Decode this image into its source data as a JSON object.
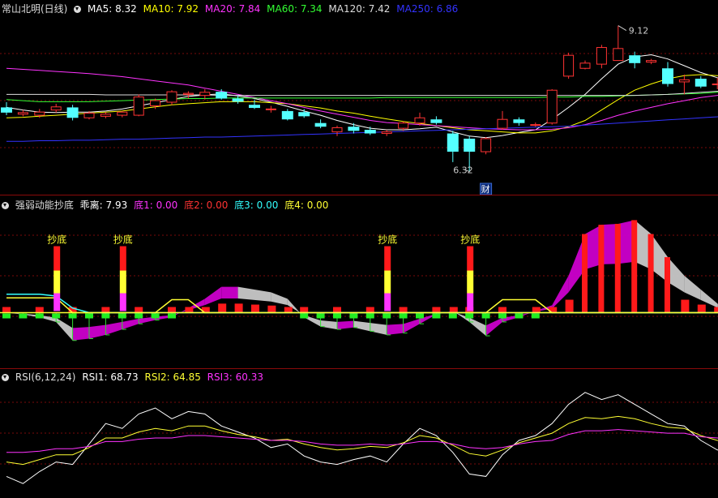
{
  "panel1": {
    "title": "常山北明(日线)",
    "ma": [
      {
        "label": "MA5: 8.32",
        "color": "#ffffff"
      },
      {
        "label": "MA10: 7.92",
        "color": "#ffff00"
      },
      {
        "label": "MA20: 7.84",
        "color": "#ff33ff"
      },
      {
        "label": "MA60: 7.34",
        "color": "#33ff33"
      },
      {
        "label": "MA120: 7.42",
        "color": "#dddddd"
      },
      {
        "label": "MA250: 6.86",
        "color": "#3333ff"
      }
    ],
    "high_label": "9.12",
    "low_label": "6.32",
    "cai_badge": "财"
  },
  "panel2": {
    "title": "强弱动能抄底",
    "items": [
      {
        "label": "乖离: 7.93",
        "color": "#ffffff"
      },
      {
        "label": "底1: 0.00",
        "color": "#ff33ff"
      },
      {
        "label": "底2: 0.00",
        "color": "#ff3333"
      },
      {
        "label": "底3: 0.00",
        "color": "#33ffff"
      },
      {
        "label": "底4: 0.00",
        "color": "#ffff33"
      }
    ],
    "buy_label": "抄底"
  },
  "panel3": {
    "title": "RSI(6,12,24)",
    "items": [
      {
        "label": "RSI1: 68.73",
        "color": "#ffffff"
      },
      {
        "label": "RSI2: 64.85",
        "color": "#ffff33"
      },
      {
        "label": "RSI3: 60.33",
        "color": "#ff33ff"
      }
    ]
  },
  "chart_data": [
    {
      "type": "candlestick",
      "title": "常山北明(日线)",
      "ylim": [
        6.0,
        9.3
      ],
      "candles": [
        {
          "o": 7.55,
          "h": 7.65,
          "l": 7.4,
          "c": 7.45
        },
        {
          "o": 7.42,
          "h": 7.5,
          "l": 7.38,
          "c": 7.45
        },
        {
          "o": 7.4,
          "h": 7.52,
          "l": 7.35,
          "c": 7.46
        },
        {
          "o": 7.5,
          "h": 7.62,
          "l": 7.45,
          "c": 7.56
        },
        {
          "o": 7.55,
          "h": 7.6,
          "l": 7.3,
          "c": 7.35
        },
        {
          "o": 7.35,
          "h": 7.48,
          "l": 7.32,
          "c": 7.44
        },
        {
          "o": 7.38,
          "h": 7.46,
          "l": 7.34,
          "c": 7.42
        },
        {
          "o": 7.4,
          "h": 7.48,
          "l": 7.36,
          "c": 7.46
        },
        {
          "o": 7.4,
          "h": 7.8,
          "l": 7.38,
          "c": 7.75
        },
        {
          "o": 7.58,
          "h": 7.72,
          "l": 7.52,
          "c": 7.68
        },
        {
          "o": 7.65,
          "h": 7.88,
          "l": 7.6,
          "c": 7.85
        },
        {
          "o": 7.8,
          "h": 7.86,
          "l": 7.72,
          "c": 7.82
        },
        {
          "o": 7.78,
          "h": 7.9,
          "l": 7.7,
          "c": 7.84
        },
        {
          "o": 7.85,
          "h": 7.9,
          "l": 7.7,
          "c": 7.72
        },
        {
          "o": 7.72,
          "h": 7.78,
          "l": 7.62,
          "c": 7.66
        },
        {
          "o": 7.6,
          "h": 7.7,
          "l": 7.52,
          "c": 7.54
        },
        {
          "o": 7.52,
          "h": 7.58,
          "l": 7.45,
          "c": 7.52
        },
        {
          "o": 7.48,
          "h": 7.52,
          "l": 7.3,
          "c": 7.32
        },
        {
          "o": 7.46,
          "h": 7.52,
          "l": 7.35,
          "c": 7.38
        },
        {
          "o": 7.25,
          "h": 7.32,
          "l": 7.15,
          "c": 7.18
        },
        {
          "o": 7.08,
          "h": 7.2,
          "l": 7.0,
          "c": 7.16
        },
        {
          "o": 7.18,
          "h": 7.25,
          "l": 7.05,
          "c": 7.1
        },
        {
          "o": 7.12,
          "h": 7.18,
          "l": 7.02,
          "c": 7.05
        },
        {
          "o": 7.05,
          "h": 7.12,
          "l": 7.0,
          "c": 7.08
        },
        {
          "o": 7.15,
          "h": 7.28,
          "l": 7.1,
          "c": 7.25
        },
        {
          "o": 7.25,
          "h": 7.45,
          "l": 7.2,
          "c": 7.35
        },
        {
          "o": 7.32,
          "h": 7.38,
          "l": 7.22,
          "c": 7.25
        },
        {
          "o": 7.05,
          "h": 7.1,
          "l": 6.5,
          "c": 6.7
        },
        {
          "o": 6.95,
          "h": 7.0,
          "l": 6.32,
          "c": 6.7
        },
        {
          "o": 6.7,
          "h": 6.98,
          "l": 6.65,
          "c": 6.95
        },
        {
          "o": 7.15,
          "h": 7.48,
          "l": 7.12,
          "c": 7.32
        },
        {
          "o": 7.32,
          "h": 7.36,
          "l": 7.2,
          "c": 7.25
        },
        {
          "o": 7.22,
          "h": 7.26,
          "l": 7.18,
          "c": 7.22
        },
        {
          "o": 7.25,
          "h": 7.9,
          "l": 7.22,
          "c": 7.88
        },
        {
          "o": 8.15,
          "h": 8.6,
          "l": 8.1,
          "c": 8.55
        },
        {
          "o": 8.3,
          "h": 8.45,
          "l": 8.28,
          "c": 8.4
        },
        {
          "o": 8.38,
          "h": 8.75,
          "l": 8.3,
          "c": 8.7
        },
        {
          "o": 8.45,
          "h": 9.12,
          "l": 8.45,
          "c": 8.68
        },
        {
          "o": 8.55,
          "h": 8.62,
          "l": 8.3,
          "c": 8.4
        },
        {
          "o": 8.42,
          "h": 8.48,
          "l": 8.38,
          "c": 8.45
        },
        {
          "o": 8.3,
          "h": 8.42,
          "l": 7.95,
          "c": 8.0
        },
        {
          "o": 8.04,
          "h": 8.18,
          "l": 7.8,
          "c": 8.08
        },
        {
          "o": 8.1,
          "h": 8.15,
          "l": 7.92,
          "c": 7.95
        },
        {
          "o": 8.0,
          "h": 8.12,
          "l": 7.9,
          "c": 8.0
        },
        {
          "o": 7.98,
          "h": 8.0,
          "l": 7.75,
          "c": 7.78
        }
      ],
      "ma_series": [
        {
          "name": "MA5",
          "values": [
            7.55,
            7.5,
            7.46,
            7.45,
            7.46,
            7.46,
            7.48,
            7.52,
            7.58,
            7.64,
            7.7,
            7.76,
            7.79,
            7.81,
            7.77,
            7.72,
            7.65,
            7.57,
            7.48,
            7.4,
            7.3,
            7.22,
            7.15,
            7.12,
            7.12,
            7.14,
            7.17,
            7.08,
            7.0,
            6.97,
            7.01,
            7.07,
            7.12,
            7.32,
            7.55,
            7.8,
            8.1,
            8.38,
            8.52,
            8.56,
            8.48,
            8.35,
            8.22,
            8.12,
            8.02
          ]
        },
        {
          "name": "MA10",
          "values": [
            7.35,
            7.36,
            7.38,
            7.4,
            7.42,
            7.44,
            7.46,
            7.48,
            7.52,
            7.56,
            7.6,
            7.62,
            7.64,
            7.66,
            7.66,
            7.66,
            7.64,
            7.62,
            7.58,
            7.54,
            7.48,
            7.44,
            7.38,
            7.33,
            7.28,
            7.24,
            7.2,
            7.16,
            7.12,
            7.1,
            7.08,
            7.06,
            7.06,
            7.1,
            7.18,
            7.3,
            7.5,
            7.7,
            7.88,
            8.0,
            8.1,
            8.16,
            8.18,
            8.16,
            8.1
          ]
        },
        {
          "name": "MA20",
          "values": [
            8.3,
            8.28,
            8.26,
            8.24,
            8.22,
            8.2,
            8.17,
            8.14,
            8.1,
            8.06,
            8.02,
            7.98,
            7.92,
            7.86,
            7.8,
            7.74,
            7.68,
            7.62,
            7.55,
            7.48,
            7.42,
            7.36,
            7.3,
            7.26,
            7.24,
            7.22,
            7.2,
            7.18,
            7.16,
            7.14,
            7.13,
            7.12,
            7.12,
            7.13,
            7.16,
            7.22,
            7.3,
            7.4,
            7.48,
            7.55,
            7.62,
            7.68,
            7.74,
            7.78,
            7.84
          ]
        },
        {
          "name": "MA60",
          "values": [
            7.7,
            7.68,
            7.66,
            7.66,
            7.66,
            7.66,
            7.67,
            7.68,
            7.69,
            7.7,
            7.71,
            7.72,
            7.72,
            7.73,
            7.73,
            7.73,
            7.73,
            7.73,
            7.73,
            7.73,
            7.73,
            7.73,
            7.73,
            7.74,
            7.74,
            7.74,
            7.74,
            7.74,
            7.74,
            7.74,
            7.74,
            7.74,
            7.74,
            7.75,
            7.75,
            7.76,
            7.76,
            7.77,
            7.78,
            7.79,
            7.8,
            7.81,
            7.82,
            7.84,
            7.85
          ]
        },
        {
          "name": "MA120",
          "values": [
            7.8,
            7.8,
            7.8,
            7.8,
            7.8,
            7.8,
            7.79,
            7.79,
            7.79,
            7.79,
            7.79,
            7.79,
            7.79,
            7.78,
            7.78,
            7.78,
            7.78,
            7.78,
            7.78,
            7.78,
            7.78,
            7.78,
            7.78,
            7.78,
            7.78,
            7.78,
            7.78,
            7.78,
            7.78,
            7.78,
            7.78,
            7.78,
            7.78,
            7.78,
            7.78,
            7.78,
            7.78,
            7.78,
            7.78,
            7.79,
            7.8,
            7.82,
            7.84,
            7.86,
            7.88
          ]
        },
        {
          "name": "MA250",
          "values": [
            6.9,
            6.9,
            6.91,
            6.91,
            6.92,
            6.92,
            6.93,
            6.94,
            6.94,
            6.95,
            6.96,
            6.97,
            6.98,
            6.98,
            6.99,
            7.0,
            7.01,
            7.02,
            7.03,
            7.04,
            7.05,
            7.06,
            7.07,
            7.08,
            7.09,
            7.1,
            7.11,
            7.12,
            7.13,
            7.14,
            7.15,
            7.16,
            7.17,
            7.18,
            7.19,
            7.21,
            7.23,
            7.25,
            7.27,
            7.29,
            7.31,
            7.33,
            7.35,
            7.37,
            7.4
          ]
        }
      ]
    },
    {
      "type": "area",
      "title": "强弱动能抄底",
      "ylim": [
        -60,
        110
      ],
      "baseline": 0,
      "buy_signals": [
        3,
        7,
        23,
        28
      ],
      "momentum": [
        0,
        -2,
        -5,
        -10,
        -30,
        -28,
        -24,
        -18,
        -12,
        -8,
        -5,
        5,
        15,
        28,
        28,
        25,
        22,
        15,
        -5,
        -15,
        -18,
        -16,
        -20,
        -24,
        -22,
        -12,
        -2,
        2,
        -10,
        -25,
        -10,
        -5,
        2,
        8,
        40,
        85,
        95,
        96,
        100,
        85,
        60,
        40,
        25,
        10,
        -10
      ],
      "yellow_line": [
        16,
        16,
        16,
        16,
        0,
        0,
        0,
        0,
        0,
        0,
        14,
        14,
        0,
        0,
        0,
        0,
        0,
        0,
        0,
        0,
        0,
        0,
        0,
        0,
        0,
        0,
        0,
        0,
        0,
        0,
        14,
        14,
        14,
        0,
        0,
        0,
        0,
        0,
        0,
        0,
        0,
        0,
        0,
        0,
        10
      ],
      "cyan_line": [
        20,
        20,
        20,
        18,
        5,
        0,
        0,
        0,
        0,
        0,
        0,
        0,
        0,
        0,
        0,
        0,
        0,
        0,
        0,
        0,
        0,
        0,
        0,
        0,
        0,
        0,
        0,
        0,
        0,
        0,
        0,
        0,
        0,
        0,
        0,
        0,
        0,
        0,
        0,
        0,
        0,
        0,
        0,
        0,
        0
      ]
    },
    {
      "type": "line",
      "title": "RSI(6,12,24)",
      "ylim": [
        0,
        100
      ],
      "series": [
        {
          "name": "RSI1",
          "values": [
            18,
            12,
            22,
            30,
            28,
            45,
            62,
            58,
            70,
            75,
            66,
            72,
            70,
            60,
            55,
            50,
            42,
            45,
            35,
            30,
            28,
            32,
            35,
            30,
            45,
            58,
            52,
            38,
            20,
            18,
            36,
            48,
            52,
            62,
            78,
            88,
            82,
            86,
            78,
            70,
            62,
            60,
            48,
            40,
            38
          ]
        },
        {
          "name": "RSI2",
          "values": [
            30,
            28,
            32,
            36,
            36,
            42,
            50,
            50,
            55,
            58,
            56,
            60,
            60,
            56,
            53,
            51,
            48,
            49,
            45,
            42,
            40,
            41,
            43,
            42,
            46,
            52,
            50,
            44,
            37,
            35,
            40,
            46,
            50,
            54,
            62,
            67,
            66,
            68,
            66,
            62,
            59,
            58,
            52,
            48,
            46
          ]
        },
        {
          "name": "RSI3",
          "values": [
            38,
            38,
            39,
            41,
            41,
            43,
            47,
            47,
            49,
            50,
            50,
            52,
            52,
            51,
            50,
            49,
            48,
            48,
            47,
            45,
            44,
            44,
            45,
            44,
            45,
            47,
            47,
            45,
            42,
            41,
            42,
            45,
            47,
            48,
            53,
            56,
            56,
            57,
            56,
            55,
            54,
            54,
            51,
            50,
            49
          ]
        }
      ]
    }
  ]
}
